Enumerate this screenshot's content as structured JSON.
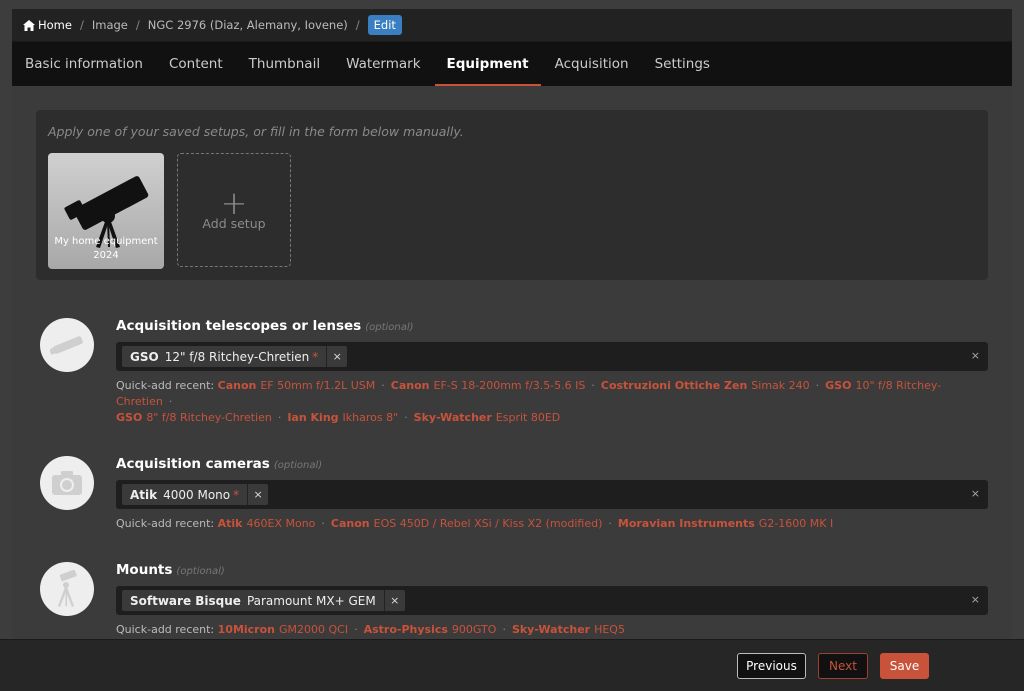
{
  "breadcrumb": {
    "home": "Home",
    "image": "Image",
    "title": "NGC 2976 (Diaz, Alemany, Iovene)",
    "active": "Edit"
  },
  "tabs": [
    "Basic information",
    "Content",
    "Thumbnail",
    "Watermark",
    "Equipment",
    "Acquisition",
    "Settings"
  ],
  "active_tab": "Equipment",
  "setups": {
    "hint": "Apply one of your saved setups, or fill in the form below manually.",
    "saved_label": "My home equipment 2024",
    "add_label": "Add setup",
    "add_icon": "+"
  },
  "optional_label": "(optional)",
  "quick_label": "Quick-add recent:",
  "clear_icon": "×",
  "tag_remove_icon": "×",
  "required_marker": "*",
  "sections": {
    "telescopes": {
      "title": "Acquisition telescopes or lenses",
      "icon": "telescope-icon",
      "tag_brand": "GSO",
      "tag_name": "12\" f/8 Ritchey-Chretien",
      "recent": [
        {
          "brand": "Canon",
          "name": "EF 50mm f/1.2L USM"
        },
        {
          "brand": "Canon",
          "name": "EF-S 18-200mm f/3.5-5.6 IS"
        },
        {
          "brand": "Costruzioni Ottiche Zen",
          "name": "Simak 240"
        },
        {
          "brand": "GSO",
          "name": "10\" f/8 Ritchey-Chretien"
        },
        {
          "brand": "GSO",
          "name": "8\" f/8 Ritchey-Chretien"
        },
        {
          "brand": "Ian King",
          "name": "Ikharos 8\""
        },
        {
          "brand": "Sky-Watcher",
          "name": "Esprit 80ED"
        }
      ]
    },
    "cameras": {
      "title": "Acquisition cameras",
      "icon": "camera-icon",
      "tag_brand": "Atik",
      "tag_name": "4000 Mono",
      "recent": [
        {
          "brand": "Atik",
          "name": "460EX Mono"
        },
        {
          "brand": "Canon",
          "name": "EOS 450D / Rebel XSi / Kiss X2 (modified)"
        },
        {
          "brand": "Moravian Instruments",
          "name": "G2-1600 MK I"
        }
      ]
    },
    "mounts": {
      "title": "Mounts",
      "icon": "mount-tripod-icon",
      "tag_brand": "Software Bisque",
      "tag_name": "Paramount MX+ GEM",
      "recent": [
        {
          "brand": "10Micron",
          "name": "GM2000 QCI"
        },
        {
          "brand": "Astro-Physics",
          "name": "900GTO"
        },
        {
          "brand": "Sky-Watcher",
          "name": "HEQ5"
        }
      ]
    }
  },
  "footer": {
    "previous": "Previous",
    "next": "Next",
    "save": "Save"
  },
  "colors": {
    "accent": "#c9523a",
    "breadcrumb_active": "#3a7fc1"
  }
}
